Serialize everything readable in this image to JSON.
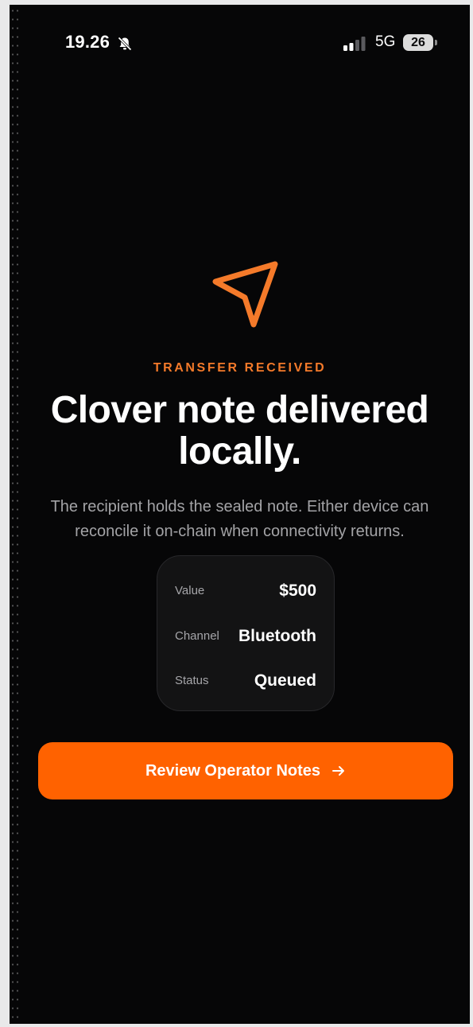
{
  "status_bar": {
    "time": "19.26",
    "network": "5G",
    "battery": "26",
    "icons": [
      "bell-slash-icon",
      "signal-icon",
      "battery-icon"
    ]
  },
  "hero": {
    "icon": "paper-plane-icon",
    "eyebrow": "TRANSFER RECEIVED",
    "headline": "Clover note delivered locally.",
    "subtext": "The recipient holds the sealed note. Either device can reconcile it on-chain when connectivity returns."
  },
  "summary": {
    "rows": [
      {
        "label": "Value",
        "value": "$500"
      },
      {
        "label": "Channel",
        "value": "Bluetooth"
      },
      {
        "label": "Status",
        "value": "Queued"
      }
    ]
  },
  "cta": {
    "label": "Review Operator Notes",
    "icon": "arrow-right-icon"
  },
  "colors": {
    "accent": "#ff6200",
    "eyebrow": "#f47a2a",
    "background": "#060607",
    "card": "#131314",
    "muted_text": "#a3a3a6"
  }
}
